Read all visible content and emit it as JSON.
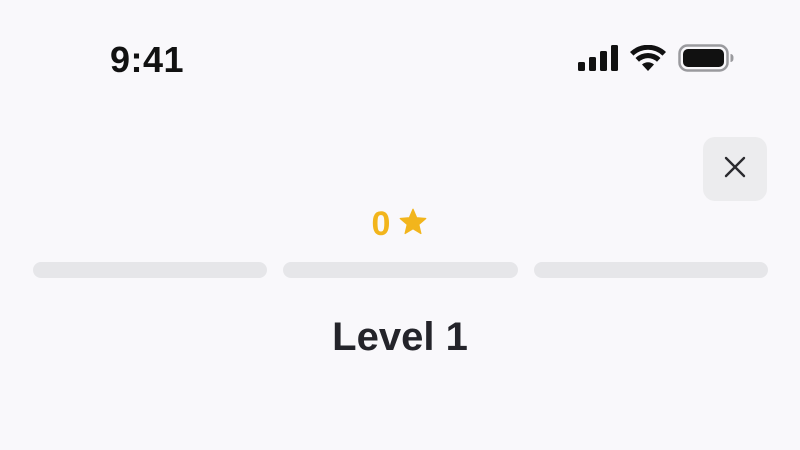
{
  "status_bar": {
    "time": "9:41",
    "icons": [
      "cellular-signal-icon",
      "wifi-icon",
      "battery-icon"
    ]
  },
  "header": {
    "close_icon": "close-icon"
  },
  "stars": {
    "count": "0",
    "icon": "star-icon",
    "color": "#f2b51c"
  },
  "progress": {
    "segments": [
      {
        "filled_fraction": 0
      },
      {
        "filled_fraction": 0
      },
      {
        "filled_fraction": 0
      }
    ],
    "track_color": "#e6e6e9",
    "fill_color": "#f2b51c"
  },
  "level": {
    "title": "Level 1"
  }
}
